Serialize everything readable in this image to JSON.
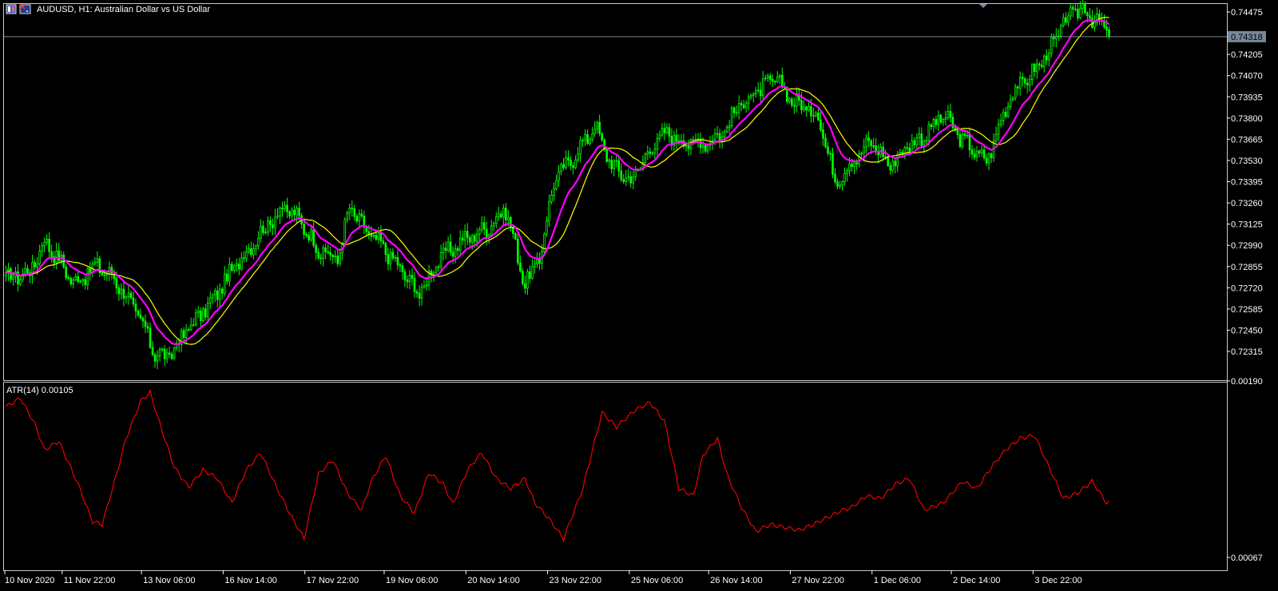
{
  "header": {
    "title": "AUDUSD, H1:  Australian Dollar vs US Dollar",
    "icons": [
      "window-icon",
      "flag-icon"
    ]
  },
  "indicator": {
    "label": "ATR(14) 0.00105"
  },
  "colors": {
    "background": "#000000",
    "axis": "#ffffff",
    "grid_border": "#c8c8c8",
    "bullish_bar": "#00ff00",
    "bearish_bar": "#00ff00",
    "ma_fast": "#ff00ff",
    "ma_slow": "#ffff00",
    "atr_line": "#ff0000",
    "current_price_line": "#778899",
    "price_tag_bg": "#778899"
  },
  "chart_data": [
    {
      "type": "candlestick",
      "title": "AUDUSD, H1:  Australian Dollar vs US Dollar",
      "symbol": "AUDUSD",
      "timeframe": "H1",
      "y_ticks": [
        "0.74475",
        "0.74205",
        "0.74070",
        "0.73935",
        "0.73800",
        "0.73665",
        "0.73530",
        "0.73395",
        "0.73260",
        "0.73125",
        "0.72990",
        "0.72855",
        "0.72720",
        "0.72585",
        "0.72450",
        "0.72315"
      ],
      "ylim": [
        0.7222,
        0.7453
      ],
      "current_price": "0.74318",
      "x_ticks": [
        "10 Nov 2020",
        "11 Nov 22:00",
        "13 Nov 06:00",
        "16 Nov 14:00",
        "17 Nov 22:00",
        "19 Nov 06:00",
        "20 Nov 14:00",
        "23 Nov 22:00",
        "25 Nov 06:00",
        "26 Nov 14:00",
        "27 Nov 22:00",
        "1 Dec 06:00",
        "2 Dec 14:00",
        "3 Dec 22:00"
      ],
      "bars_count": 460,
      "close_path": {
        "x_index": [
          0,
          10,
          16,
          22,
          28,
          38,
          45,
          52,
          58,
          62,
          68,
          75,
          85,
          95,
          105,
          115,
          122,
          130,
          138,
          143,
          150,
          158,
          165,
          172,
          180,
          190,
          200,
          208,
          216,
          222,
          228,
          236,
          245,
          252,
          260,
          268,
          272,
          276,
          282,
          290,
          298,
          306,
          314,
          320,
          328,
          338,
          345,
          352,
          360,
          368,
          375,
          383,
          390,
          398,
          408,
          418,
          428,
          435,
          442,
          448,
          455,
          459
        ],
        "close": [
          0.7278,
          0.7282,
          0.7302,
          0.729,
          0.7275,
          0.7286,
          0.7278,
          0.7262,
          0.7245,
          0.723,
          0.7228,
          0.7245,
          0.7262,
          0.7285,
          0.7305,
          0.7323,
          0.7316,
          0.7296,
          0.729,
          0.7323,
          0.7308,
          0.7296,
          0.7282,
          0.7268,
          0.729,
          0.7302,
          0.731,
          0.7322,
          0.7274,
          0.729,
          0.734,
          0.7355,
          0.7375,
          0.735,
          0.734,
          0.736,
          0.7368,
          0.737,
          0.7365,
          0.7364,
          0.737,
          0.739,
          0.7398,
          0.7405,
          0.739,
          0.7382,
          0.734,
          0.7352,
          0.7365,
          0.735,
          0.7362,
          0.737,
          0.7382,
          0.7366,
          0.7352,
          0.7395,
          0.741,
          0.7425,
          0.7445,
          0.745,
          0.744,
          0.7432
        ]
      },
      "series": [
        {
          "name": "",
          "kind": "moving-average-fast",
          "color": "#ff00ff"
        },
        {
          "name": "",
          "kind": "moving-average-slow",
          "color": "#ffff00"
        }
      ]
    },
    {
      "type": "line",
      "title": "ATR(14) 0.00105",
      "y_ticks": [
        "0.00190",
        "0.00067"
      ],
      "ylim": [
        0.00067,
        0.0019
      ],
      "series": [
        {
          "name": "ATR(14)",
          "color": "#ff0000",
          "x_index": [
            0,
            6,
            12,
            16,
            22,
            30,
            36,
            40,
            46,
            50,
            56,
            60,
            64,
            70,
            76,
            82,
            88,
            94,
            100,
            106,
            112,
            118,
            124,
            130,
            136,
            142,
            148,
            152,
            158,
            164,
            170,
            176,
            182,
            186,
            192,
            198,
            204,
            210,
            216,
            220,
            226,
            232,
            240,
            248,
            254,
            262,
            268,
            274,
            280,
            286,
            290,
            296,
            300,
            306,
            312,
            318,
            324,
            330,
            336,
            342,
            348,
            352,
            358,
            364,
            370,
            376,
            382,
            390,
            398,
            404,
            410,
            416,
            422,
            428,
            434,
            440,
            446,
            452,
            458
          ],
          "values": [
            0.00172,
            0.00178,
            0.0016,
            0.00142,
            0.00148,
            0.00118,
            0.00092,
            0.0009,
            0.00125,
            0.0015,
            0.00176,
            0.00182,
            0.0016,
            0.0013,
            0.00116,
            0.00128,
            0.00122,
            0.00105,
            0.00128,
            0.0014,
            0.00118,
            0.00098,
            0.0008,
            0.00125,
            0.00135,
            0.00112,
            0.001,
            0.0012,
            0.00138,
            0.0011,
            0.00098,
            0.00126,
            0.00118,
            0.00104,
            0.00128,
            0.0014,
            0.00122,
            0.00115,
            0.00122,
            0.00105,
            0.00094,
            0.0008,
            0.00115,
            0.00168,
            0.00158,
            0.0017,
            0.00175,
            0.00162,
            0.00115,
            0.0011,
            0.00138,
            0.0015,
            0.00125,
            0.00102,
            0.00085,
            0.0009,
            0.00088,
            0.00086,
            0.0009,
            0.00095,
            0.001,
            0.00102,
            0.0011,
            0.00108,
            0.00118,
            0.00122,
            0.001,
            0.00105,
            0.0012,
            0.00115,
            0.0013,
            0.00142,
            0.0015,
            0.00152,
            0.0013,
            0.00108,
            0.00112,
            0.0012,
            0.00105
          ]
        }
      ]
    }
  ]
}
